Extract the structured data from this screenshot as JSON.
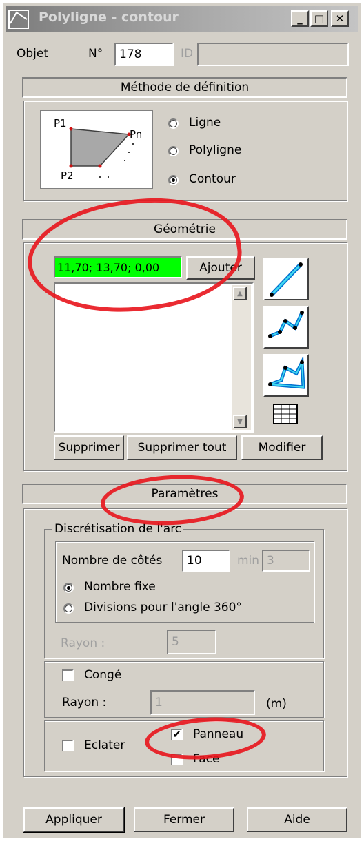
{
  "window": {
    "title": "Polyligne - contour",
    "min_symbol": "_",
    "max_symbol": "□",
    "close_symbol": "✕"
  },
  "objet": {
    "label": "Objet",
    "numero_label": "N°",
    "numero_value": "178",
    "id_label": "ID",
    "id_value": ""
  },
  "methode": {
    "header": "Méthode de définition",
    "diagram_labels": {
      "p1": "P1",
      "pn": "Pn",
      "p2": "P2"
    },
    "options": [
      {
        "label": "Ligne",
        "selected": false
      },
      {
        "label": "Polyligne",
        "selected": false
      },
      {
        "label": "Contour",
        "selected": true
      }
    ]
  },
  "geometrie": {
    "header": "Géométrie",
    "input_value": "11,70; 13,70; 0,00",
    "input_color": "#00ff00",
    "ajouter_label": "Ajouter",
    "supprimer_label": "Supprimer",
    "supprimer_tout_label": "Supprimer tout",
    "modifier_label": "Modifier",
    "icon_names": [
      "line-tool-icon",
      "polyline-tool-icon",
      "contour-tool-icon",
      "table-grid-icon"
    ]
  },
  "parametres": {
    "header": "Paramètres",
    "discretisation_legend": "Discrétisation de l'arc",
    "nombre_cotes_label": "Nombre de côtés",
    "nombre_cotes_value": "10",
    "min_label": "min",
    "min_value": "3",
    "options": [
      {
        "label": "Nombre fixe",
        "selected": true
      },
      {
        "label": "Divisions pour l'angle 360°",
        "selected": false
      }
    ],
    "rayon_disc_label": "Rayon :",
    "rayon_disc_value": "5",
    "conge_label": "Congé",
    "conge_checked": false,
    "rayon_label": "Rayon :",
    "rayon_value": "1",
    "rayon_unit": "(m)",
    "eclater_label": "Eclater",
    "eclater_checked": false,
    "panneau_label": "Panneau",
    "panneau_checked": true,
    "face_label": "Face",
    "face_checked": false
  },
  "footer": {
    "appliquer_label": "Appliquer",
    "fermer_label": "Fermer",
    "aide_label": "Aide"
  },
  "annotation_color": "#e8141c"
}
